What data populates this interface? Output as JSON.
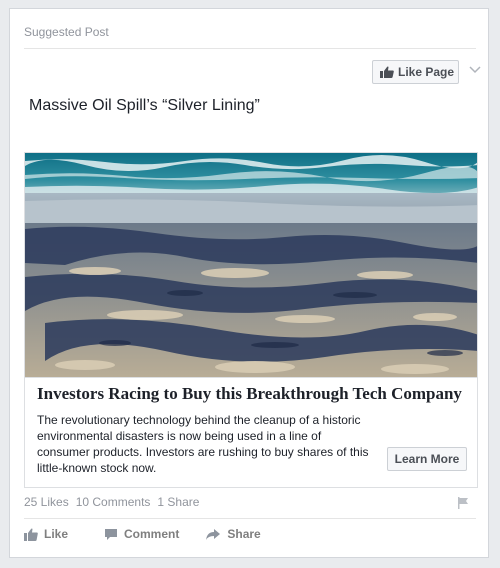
{
  "post": {
    "label": "Suggested Post",
    "like_page_label": "Like Page",
    "headline": "Massive Oil Spill’s “Silver Lining”"
  },
  "ad": {
    "title": "Investors Racing to Buy this Breakthrough Tech Company",
    "description": "The revolutionary technology behind the cleanup of a historic environmental disasters is now being used in a line of consumer products. Investors are rushing to buy shares of this little-known stock now.",
    "cta_label": "Learn More"
  },
  "stats": {
    "likes": "25 Likes",
    "comments": "10 Comments",
    "shares": "1 Share"
  },
  "actions": {
    "like": "Like",
    "comment": "Comment",
    "share": "Share"
  },
  "icons": {
    "like_page": "thumbs-up-icon",
    "menu": "chevron-down-icon",
    "report": "flag-icon",
    "like": "thumbs-up-icon",
    "comment": "comment-icon",
    "share": "share-arrow-icon"
  },
  "colors": {
    "card_bg": "#ffffff",
    "page_bg": "#e9ebee",
    "muted_text": "#90949c",
    "action_text": "#7f7f7f",
    "button_text": "#4b4f56"
  }
}
